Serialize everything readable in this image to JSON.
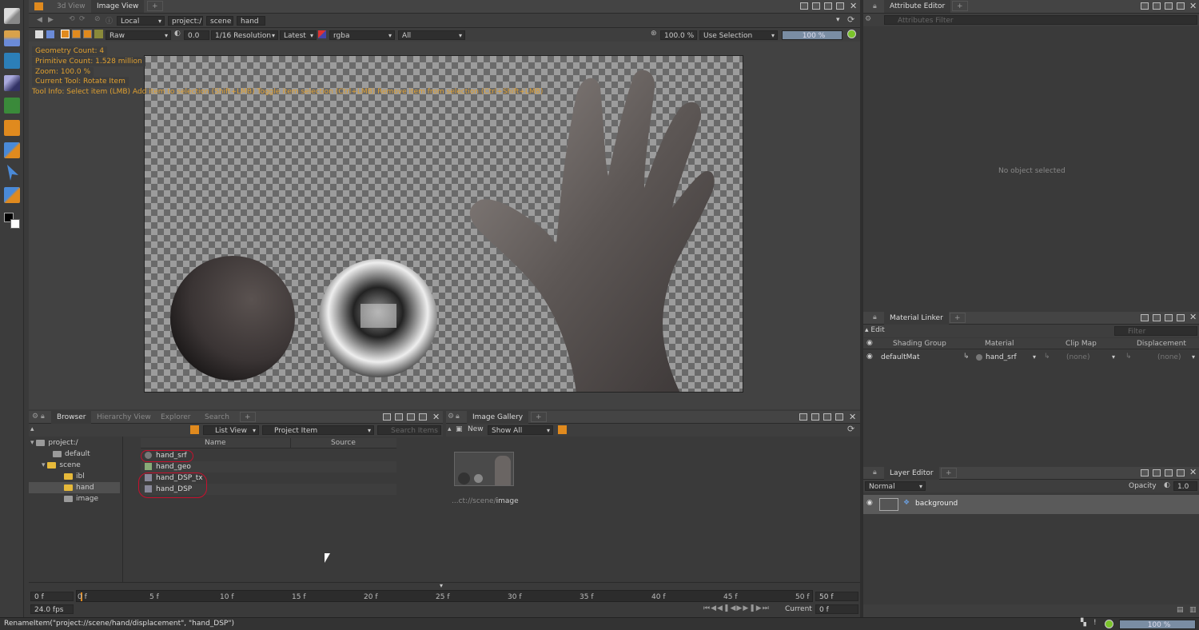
{
  "viewport": {
    "tabs": [
      "3d View",
      "Image View"
    ],
    "location": "Local",
    "breadcrumb": [
      "project:/",
      "scene",
      "hand"
    ],
    "toolbar": {
      "display": "Raw",
      "exposure": "0.0",
      "resolution": "1/16 Resolution",
      "version": "Latest",
      "channels": "rgba",
      "layer": "All",
      "zoom": "100.0 %",
      "selection": "Use Selection",
      "progress": "100 %"
    },
    "hud": [
      "Geometry Count: 4",
      "Primitive Count: 1.528 million",
      "Zoom: 100.0 %",
      "Current Tool: Rotate Item",
      "Tool Info: Select item (LMB)  Add item to selection (Shift+LMB)  Toggle item selection (Ctrl+LMB)  Remove item from selection (Ctrl+Shift+LMB)"
    ]
  },
  "attribute_editor": {
    "title": "Attribute Editor",
    "filter_placeholder": "Attributes Filter",
    "empty": "No object selected"
  },
  "material_linker": {
    "title": "Material Linker",
    "edit": "Edit",
    "filter_placeholder": "Filter",
    "headers": [
      "Shading Group",
      "Material",
      "Clip Map",
      "Displacement"
    ],
    "row": {
      "group": "defaultMat",
      "material": "hand_srf",
      "clip": "(none)",
      "disp": "(none)"
    }
  },
  "browser": {
    "tabs": [
      "Browser",
      "Hierarchy View",
      "Explorer",
      "Search"
    ],
    "view": "List View",
    "scope": "Project Item",
    "search_placeholder": "Search Items",
    "tree": [
      "project:/",
      "default",
      "scene",
      "ibl",
      "hand",
      "image"
    ],
    "headers": [
      "Name",
      "Source"
    ],
    "items": [
      "hand_srf",
      "hand_geo",
      "hand_DSP_tx",
      "hand_DSP"
    ]
  },
  "gallery": {
    "title": "Image Gallery",
    "new": "New",
    "show": "Show All",
    "caption_prefix": "...ct://scene/",
    "caption_name": "image"
  },
  "layer_editor": {
    "title": "Layer Editor",
    "blend": "Normal",
    "opacity_label": "Opacity",
    "opacity": "1.0",
    "layer": "background"
  },
  "timeline": {
    "start": "0 f",
    "end": "50 f",
    "ticks": [
      "0 f",
      "5 f",
      "10 f",
      "15 f",
      "20 f",
      "25 f",
      "30 f",
      "35 f",
      "40 f",
      "45 f",
      "50 f"
    ],
    "fps": "24.0 fps",
    "current_label": "Current",
    "current": "0 f"
  },
  "status": {
    "message": "RenameItem(\"project://scene/hand/displacement\", \"hand_DSP\")",
    "progress": "100 %"
  }
}
